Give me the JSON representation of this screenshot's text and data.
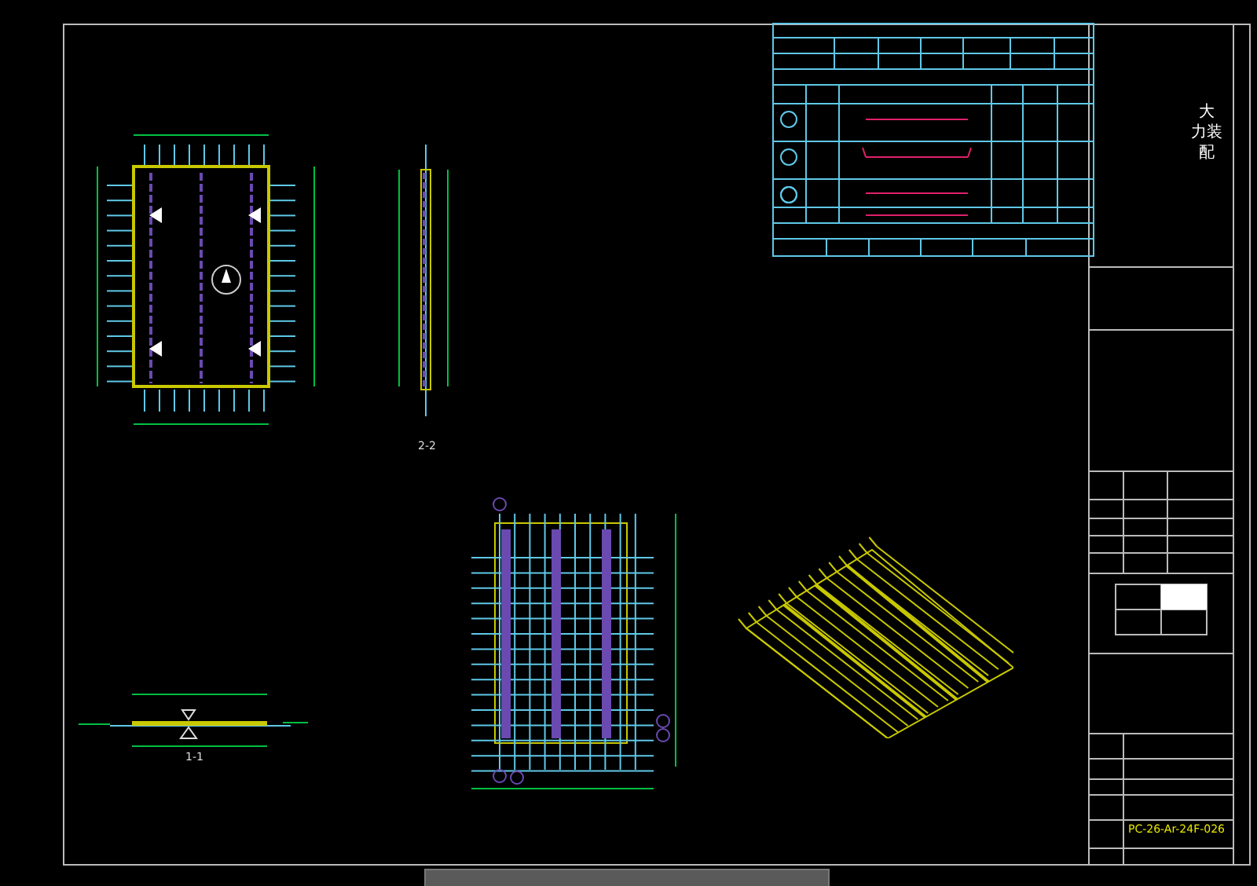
{
  "sheet": {
    "title_lines": [
      "大",
      "力装",
      "配"
    ],
    "drawing_number": "PC-26-Ar-24F-026"
  },
  "views": [
    {
      "kind": "section",
      "label": "2-2"
    },
    {
      "kind": "section",
      "label": "1-1"
    }
  ]
}
